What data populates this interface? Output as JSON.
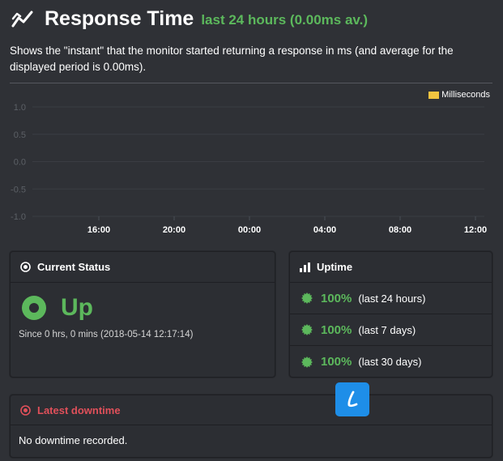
{
  "header": {
    "title": "Response Time",
    "subtitle": "last 24 hours (0.00ms av.)",
    "description": "Shows the \"instant\" that the monitor started returning a response in ms (and average for the displayed period is 0.00ms)."
  },
  "chart_data": {
    "type": "line",
    "series": [
      {
        "name": "Milliseconds",
        "values": []
      }
    ],
    "legend": {
      "label": "Milliseconds",
      "placement": "top-right",
      "color": "#f0c340"
    },
    "y_ticks": [
      "1.0",
      "0.5",
      "0.0",
      "-0.5",
      "-1.0"
    ],
    "ylim": [
      -1.0,
      1.0
    ],
    "x_ticks": [
      "16:00",
      "20:00",
      "00:00",
      "04:00",
      "08:00",
      "12:00"
    ],
    "grid": true
  },
  "current_status": {
    "title": "Current Status",
    "state": "Up",
    "since": "Since 0 hrs, 0 mins (2018-05-14 12:17:14)"
  },
  "uptime": {
    "title": "Uptime",
    "rows": [
      {
        "pct": "100%",
        "period": "(last 24 hours)"
      },
      {
        "pct": "100%",
        "period": "(last 7 days)"
      },
      {
        "pct": "100%",
        "period": "(last 30 days)"
      }
    ]
  },
  "downtime": {
    "title": "Latest downtime",
    "message": "No downtime recorded."
  },
  "colors": {
    "background": "#2f3136",
    "accent_green": "#5cb85c",
    "alert_red": "#e0505a",
    "legend_yellow": "#f0c340"
  }
}
